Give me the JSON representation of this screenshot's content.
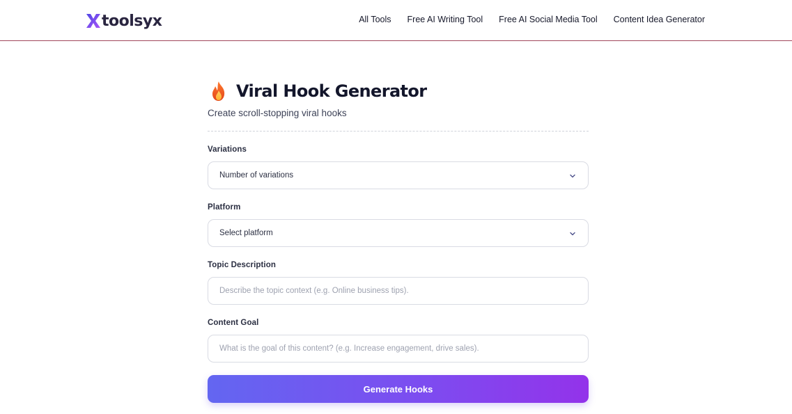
{
  "header": {
    "logo_text": "toolsyx",
    "nav": [
      {
        "label": "All Tools"
      },
      {
        "label": "Free AI Writing Tool"
      },
      {
        "label": "Free AI Social Media Tool"
      },
      {
        "label": "Content Idea Generator"
      }
    ]
  },
  "tool": {
    "title": "Viral Hook Generator",
    "subtitle": "Create scroll-stopping viral hooks",
    "icon": "fire-icon"
  },
  "form": {
    "variations": {
      "label": "Variations",
      "value": "Number of variations"
    },
    "platform": {
      "label": "Platform",
      "value": "Select platform"
    },
    "topic": {
      "label": "Topic Description",
      "placeholder": "Describe the topic context (e.g. Online business tips)."
    },
    "goal": {
      "label": "Content Goal",
      "placeholder": "What is the goal of this content? (e.g. Increase engagement, drive sales)."
    },
    "submit_label": "Generate Hooks"
  },
  "colors": {
    "brand": "#6c3ff0",
    "button_start": "#6366f1",
    "button_end": "#9333ea",
    "header_border": "#a0465a"
  }
}
